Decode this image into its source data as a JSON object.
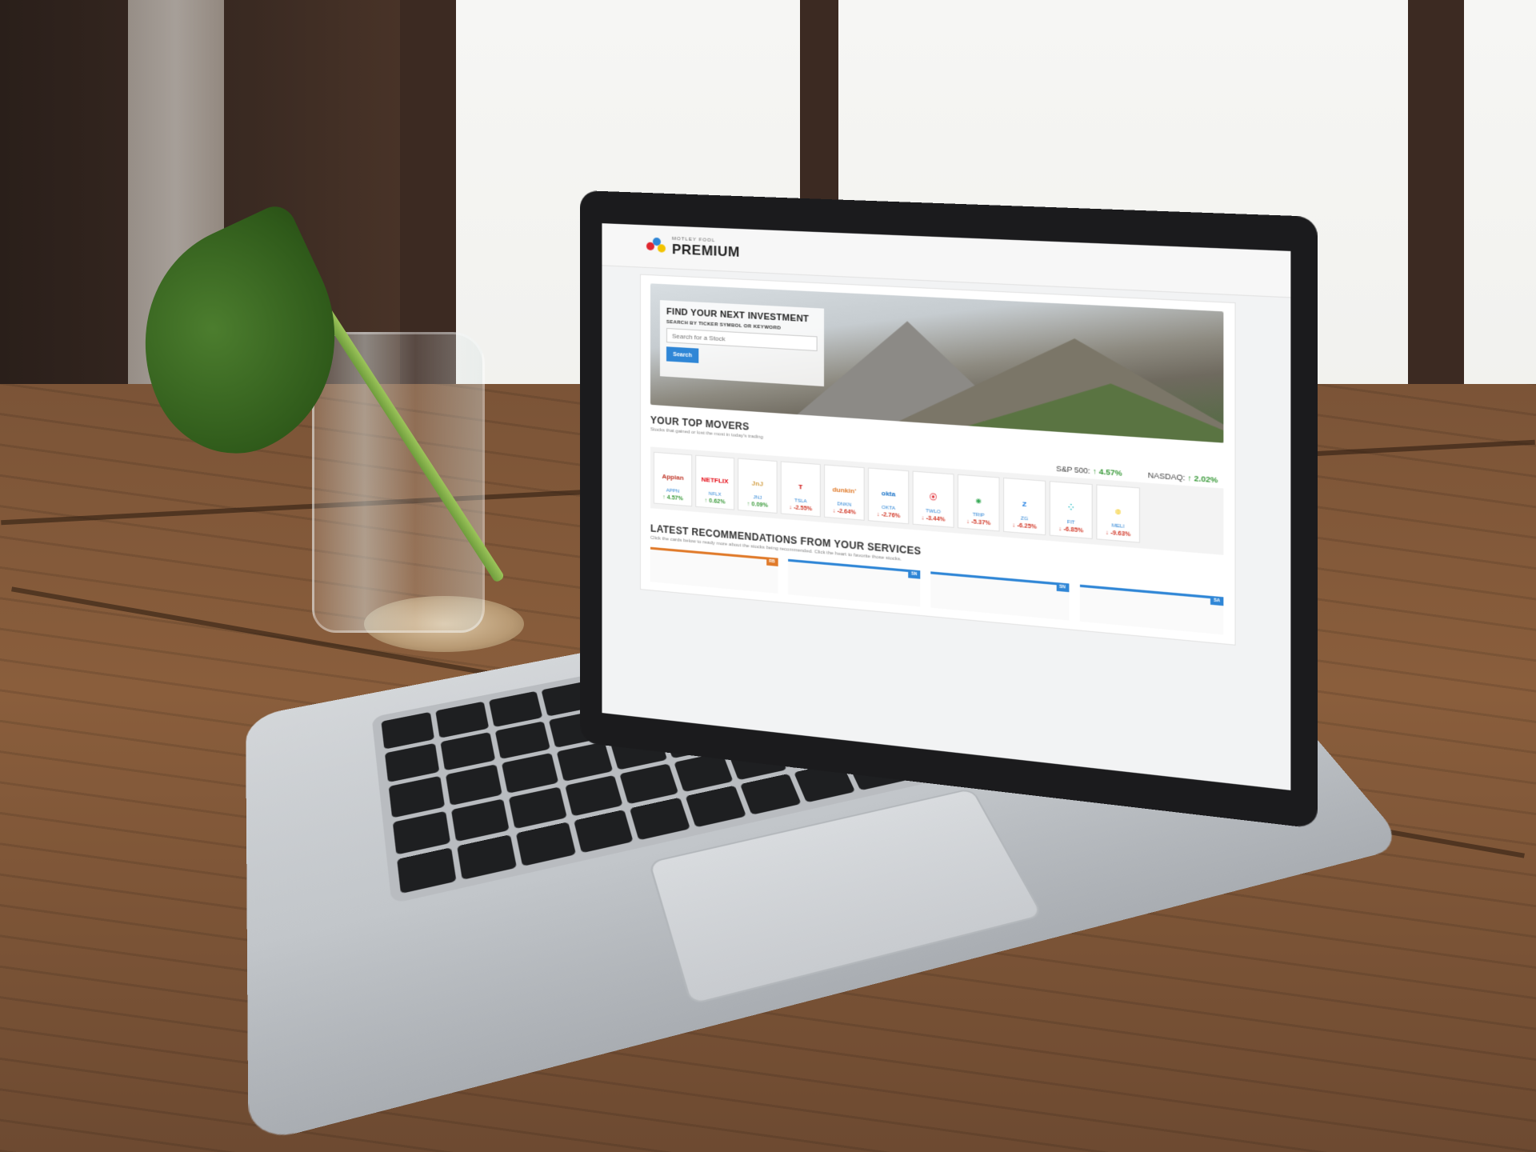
{
  "brand": {
    "small": "MOTLEY FOOL",
    "big": "PREMIUM"
  },
  "hero": {
    "title": "FIND YOUR NEXT INVESTMENT",
    "subtitle": "SEARCH BY TICKER SYMBOL OR KEYWORD",
    "search_placeholder": "Search for a Stock",
    "search_button": "Search"
  },
  "top_movers": {
    "title": "YOUR TOP MOVERS",
    "subtitle": "Stocks that gained or lost the most in today's trading",
    "indices": [
      {
        "label": "S&P 500:",
        "arrow": "↑",
        "value": "4.57%"
      },
      {
        "label": "NASDAQ:",
        "arrow": "↑",
        "value": "2.02%"
      }
    ],
    "items": [
      {
        "logo": "Appian",
        "logo_color": "#c0392b",
        "ticker": "APPN",
        "arrow": "↑",
        "change": "4.57%",
        "dir": "up"
      },
      {
        "logo": "NETFLIX",
        "logo_color": "#e50914",
        "ticker": "NFLX",
        "arrow": "↑",
        "change": "0.62%",
        "dir": "up"
      },
      {
        "logo": "JnJ",
        "logo_color": "#d4a24a",
        "ticker": "JNJ",
        "arrow": "↑",
        "change": "0.09%",
        "dir": "up"
      },
      {
        "logo": "T",
        "logo_color": "#cc0000",
        "ticker": "TSLA",
        "arrow": "↓",
        "change": "-2.55%",
        "dir": "down"
      },
      {
        "logo": "dunkin'",
        "logo_color": "#e07a2a",
        "ticker": "DNKN",
        "arrow": "↓",
        "change": "-2.64%",
        "dir": "down"
      },
      {
        "logo": "okta",
        "logo_color": "#1a73c8",
        "ticker": "OKTA",
        "arrow": "↓",
        "change": "-2.76%",
        "dir": "down"
      },
      {
        "logo": "⦿",
        "logo_color": "#e0262f",
        "ticker": "TWLO",
        "arrow": "↓",
        "change": "-3.44%",
        "dir": "down"
      },
      {
        "logo": "◉",
        "logo_color": "#34a853",
        "ticker": "TRIP",
        "arrow": "↓",
        "change": "-5.37%",
        "dir": "down"
      },
      {
        "logo": "Z",
        "logo_color": "#1277e1",
        "ticker": "ZG",
        "arrow": "↓",
        "change": "-6.25%",
        "dir": "down"
      },
      {
        "logo": "⁘",
        "logo_color": "#00b0b9",
        "ticker": "FIT",
        "arrow": "↓",
        "change": "-6.85%",
        "dir": "down"
      },
      {
        "logo": "◍",
        "logo_color": "#f2c300",
        "ticker": "MELI",
        "arrow": "↓",
        "change": "-9.63%",
        "dir": "down"
      }
    ]
  },
  "recommendations": {
    "title": "LATEST RECOMMENDATIONS FROM YOUR SERVICES",
    "subtitle": "Click the cards below to ready more about the stocks being recommended. Click the heart to favorite those stocks.",
    "cards": [
      {
        "badge": "RB",
        "color": "#e07a2a"
      },
      {
        "badge": "SN",
        "color": "#2f86d6"
      },
      {
        "badge": "SN",
        "color": "#2f86d6"
      },
      {
        "badge": "SA",
        "color": "#2f86d6"
      }
    ]
  }
}
